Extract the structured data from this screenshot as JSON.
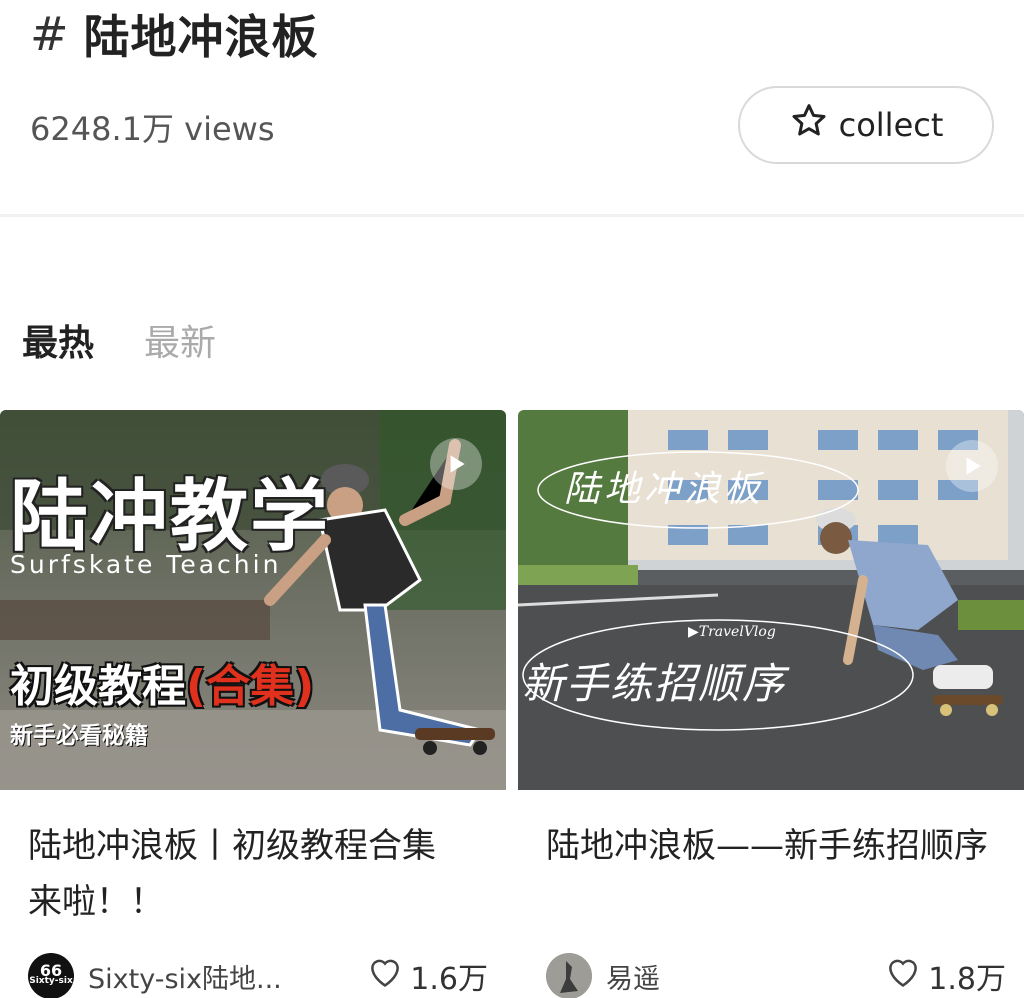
{
  "topic": {
    "hash": "#",
    "title": "陆地冲浪板",
    "views": "6248.1万 views",
    "collect_label": "collect"
  },
  "sort_tabs": [
    {
      "label": "最热",
      "active": true
    },
    {
      "label": "最新",
      "active": false
    }
  ],
  "posts": [
    {
      "thumb_text": {
        "big": "陆冲教学",
        "sub": "Surfskate Teachin",
        "mid": "初级教程",
        "mid_red": "(合集)",
        "small": "新手必看秘籍"
      },
      "title": "陆地冲浪板丨初级教程合集来啦！！",
      "author": "Sixty-six陆地...",
      "avatar_text": "66",
      "avatar_caption": "Sixty-six",
      "likes": "1.6万"
    },
    {
      "thumb_text": {
        "script_top": "陆地冲浪板",
        "tag": "▶TravelVlog",
        "script_bottom": "新手练招顺序"
      },
      "title": "陆地冲浪板——新手练招顺序",
      "author": "易遥",
      "likes": "1.8万"
    }
  ],
  "colors": {
    "accent_red": "#e0301e",
    "muted": "#aaaaaa",
    "text": "#222222"
  },
  "icons": [
    "star-outline-icon",
    "play-icon",
    "heart-outline-icon"
  ]
}
